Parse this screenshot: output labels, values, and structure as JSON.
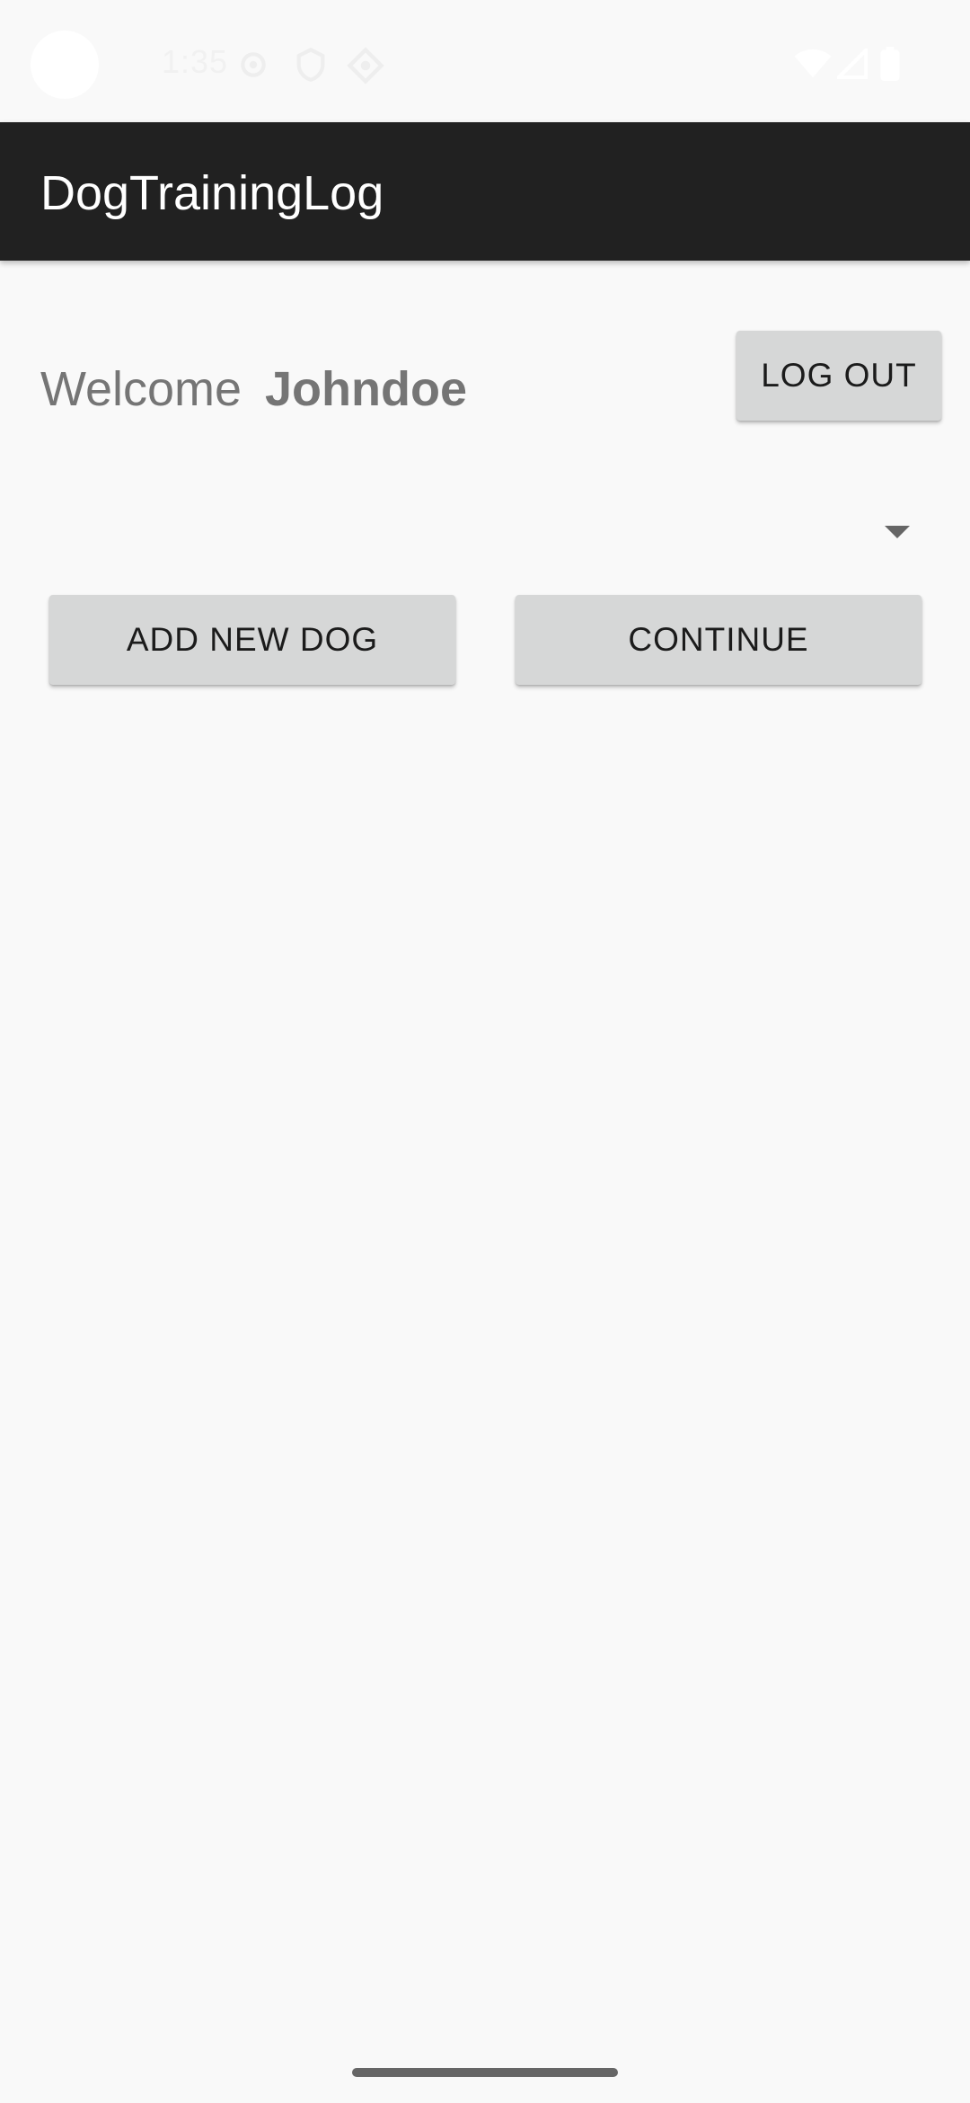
{
  "status_bar": {
    "time": "1:35",
    "icons": [
      "settings-gear-icon",
      "location-shield-icon",
      "nfc-diamond-icon",
      "wifi-icon",
      "cell-signal-icon",
      "battery-icon"
    ]
  },
  "app_bar": {
    "title": "DogTrainingLog"
  },
  "welcome": {
    "label": "Welcome",
    "username": "Johndoe"
  },
  "buttons": {
    "logout": "LOG OUT",
    "add_new_dog": "ADD NEW DOG",
    "continue": "CONTINUE"
  },
  "dog_spinner": {
    "selected_value": ""
  },
  "colors": {
    "app_bar_bg": "#212121",
    "background": "#f9f9f9",
    "button_bg": "#d6d7d7",
    "welcome_text": "#757575"
  }
}
